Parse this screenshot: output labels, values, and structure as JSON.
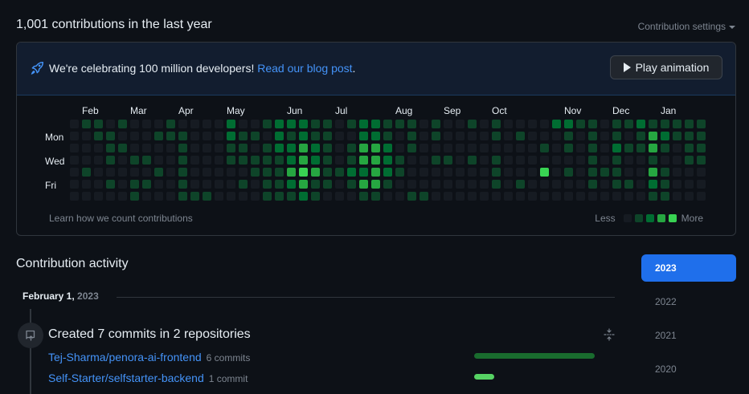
{
  "header": {
    "title": "1,001 contributions in the last year",
    "settings_label": "Contribution settings"
  },
  "banner": {
    "text": "We're celebrating 100 million developers!",
    "link_text": "Read our blog post",
    "suffix": ".",
    "button_label": "Play animation"
  },
  "graph": {
    "months": [
      "Feb",
      "Mar",
      "Apr",
      "May",
      "Jun",
      "Jul",
      "Aug",
      "Sep",
      "Oct",
      "Nov",
      "Dec",
      "Jan"
    ],
    "days": [
      "Mon",
      "Wed",
      "Fri"
    ],
    "learn_text": "Learn how we count contributions",
    "legend_less": "Less",
    "legend_more": "More",
    "level_colors": [
      "#161b22",
      "#0e4429",
      "#006d32",
      "#26a641",
      "#39d353"
    ],
    "weeks": [
      [
        0,
        0,
        0,
        0,
        0,
        0,
        0
      ],
      [
        1,
        0,
        0,
        0,
        1,
        0,
        0
      ],
      [
        1,
        1,
        0,
        0,
        0,
        0,
        0
      ],
      [
        0,
        1,
        1,
        1,
        0,
        1,
        0
      ],
      [
        1,
        0,
        1,
        0,
        0,
        0,
        0
      ],
      [
        0,
        0,
        0,
        1,
        0,
        1,
        1
      ],
      [
        0,
        0,
        0,
        1,
        0,
        1,
        0
      ],
      [
        0,
        1,
        0,
        0,
        1,
        0,
        0
      ],
      [
        1,
        1,
        0,
        0,
        0,
        0,
        0
      ],
      [
        0,
        1,
        1,
        1,
        1,
        1,
        1
      ],
      [
        0,
        0,
        0,
        0,
        0,
        0,
        1
      ],
      [
        0,
        0,
        0,
        0,
        0,
        0,
        1
      ],
      [
        0,
        0,
        0,
        0,
        0,
        0,
        0
      ],
      [
        2,
        2,
        1,
        1,
        0,
        0,
        0
      ],
      [
        0,
        1,
        1,
        1,
        0,
        1,
        0
      ],
      [
        0,
        1,
        0,
        1,
        1,
        0,
        0
      ],
      [
        1,
        0,
        1,
        1,
        1,
        1,
        1
      ],
      [
        2,
        2,
        2,
        1,
        1,
        1,
        1
      ],
      [
        2,
        1,
        2,
        2,
        3,
        2,
        1
      ],
      [
        2,
        2,
        3,
        3,
        4,
        3,
        2
      ],
      [
        1,
        1,
        2,
        2,
        3,
        1,
        1
      ],
      [
        1,
        1,
        1,
        1,
        1,
        1,
        0
      ],
      [
        0,
        0,
        0,
        0,
        1,
        0,
        0
      ],
      [
        1,
        0,
        1,
        1,
        2,
        1,
        0
      ],
      [
        2,
        2,
        3,
        3,
        2,
        3,
        1
      ],
      [
        2,
        2,
        3,
        3,
        3,
        3,
        1
      ],
      [
        1,
        1,
        2,
        2,
        2,
        1,
        0
      ],
      [
        1,
        0,
        0,
        1,
        1,
        0,
        0
      ],
      [
        1,
        1,
        1,
        0,
        0,
        0,
        1
      ],
      [
        0,
        0,
        0,
        0,
        0,
        0,
        1
      ],
      [
        1,
        1,
        0,
        1,
        0,
        0,
        0
      ],
      [
        0,
        0,
        0,
        1,
        0,
        0,
        0
      ],
      [
        0,
        0,
        0,
        0,
        0,
        0,
        0
      ],
      [
        1,
        0,
        0,
        1,
        0,
        0,
        0
      ],
      [
        0,
        0,
        0,
        0,
        0,
        0,
        0
      ],
      [
        1,
        1,
        0,
        1,
        1,
        1,
        0
      ],
      [
        0,
        0,
        0,
        0,
        0,
        0,
        0
      ],
      [
        0,
        1,
        0,
        0,
        0,
        1,
        0
      ],
      [
        0,
        0,
        0,
        0,
        0,
        0,
        0
      ],
      [
        0,
        0,
        1,
        0,
        4,
        0,
        0
      ],
      [
        2,
        0,
        0,
        0,
        0,
        0,
        0
      ],
      [
        2,
        1,
        1,
        0,
        1,
        0,
        0
      ],
      [
        1,
        0,
        0,
        0,
        0,
        0,
        0
      ],
      [
        1,
        1,
        1,
        1,
        1,
        1,
        0
      ],
      [
        0,
        0,
        0,
        0,
        1,
        0,
        0
      ],
      [
        1,
        1,
        2,
        1,
        1,
        1,
        0
      ],
      [
        1,
        0,
        1,
        0,
        0,
        1,
        0
      ],
      [
        2,
        1,
        1,
        0,
        0,
        0,
        0
      ],
      [
        1,
        3,
        3,
        1,
        3,
        2,
        1
      ],
      [
        1,
        2,
        1,
        0,
        1,
        1,
        1
      ],
      [
        1,
        1,
        0,
        0,
        0,
        0,
        0
      ],
      [
        1,
        1,
        1,
        1,
        0,
        0,
        0
      ],
      [
        1,
        1,
        1,
        1,
        0,
        0,
        0
      ]
    ]
  },
  "activity": {
    "title": "Contribution activity",
    "date_label": "February 1,",
    "date_year": "2023",
    "commit_title": "Created 7 commits in 2 repositories",
    "repos": [
      {
        "name": "Tej-Sharma/penora-ai-frontend",
        "count": "6 commits",
        "fraction": 0.857,
        "color": "#196c2e"
      },
      {
        "name": "Self-Starter/selfstarter-backend",
        "count": "1 commit",
        "fraction": 0.143,
        "color": "#56d364"
      }
    ]
  },
  "years": [
    {
      "label": "2023",
      "active": true
    },
    {
      "label": "2022",
      "active": false
    },
    {
      "label": "2021",
      "active": false
    },
    {
      "label": "2020",
      "active": false
    }
  ],
  "icons": {
    "banner": "rocket-icon",
    "play": "play-icon",
    "commit": "repo-push-icon",
    "collapse": "fold-icon"
  }
}
